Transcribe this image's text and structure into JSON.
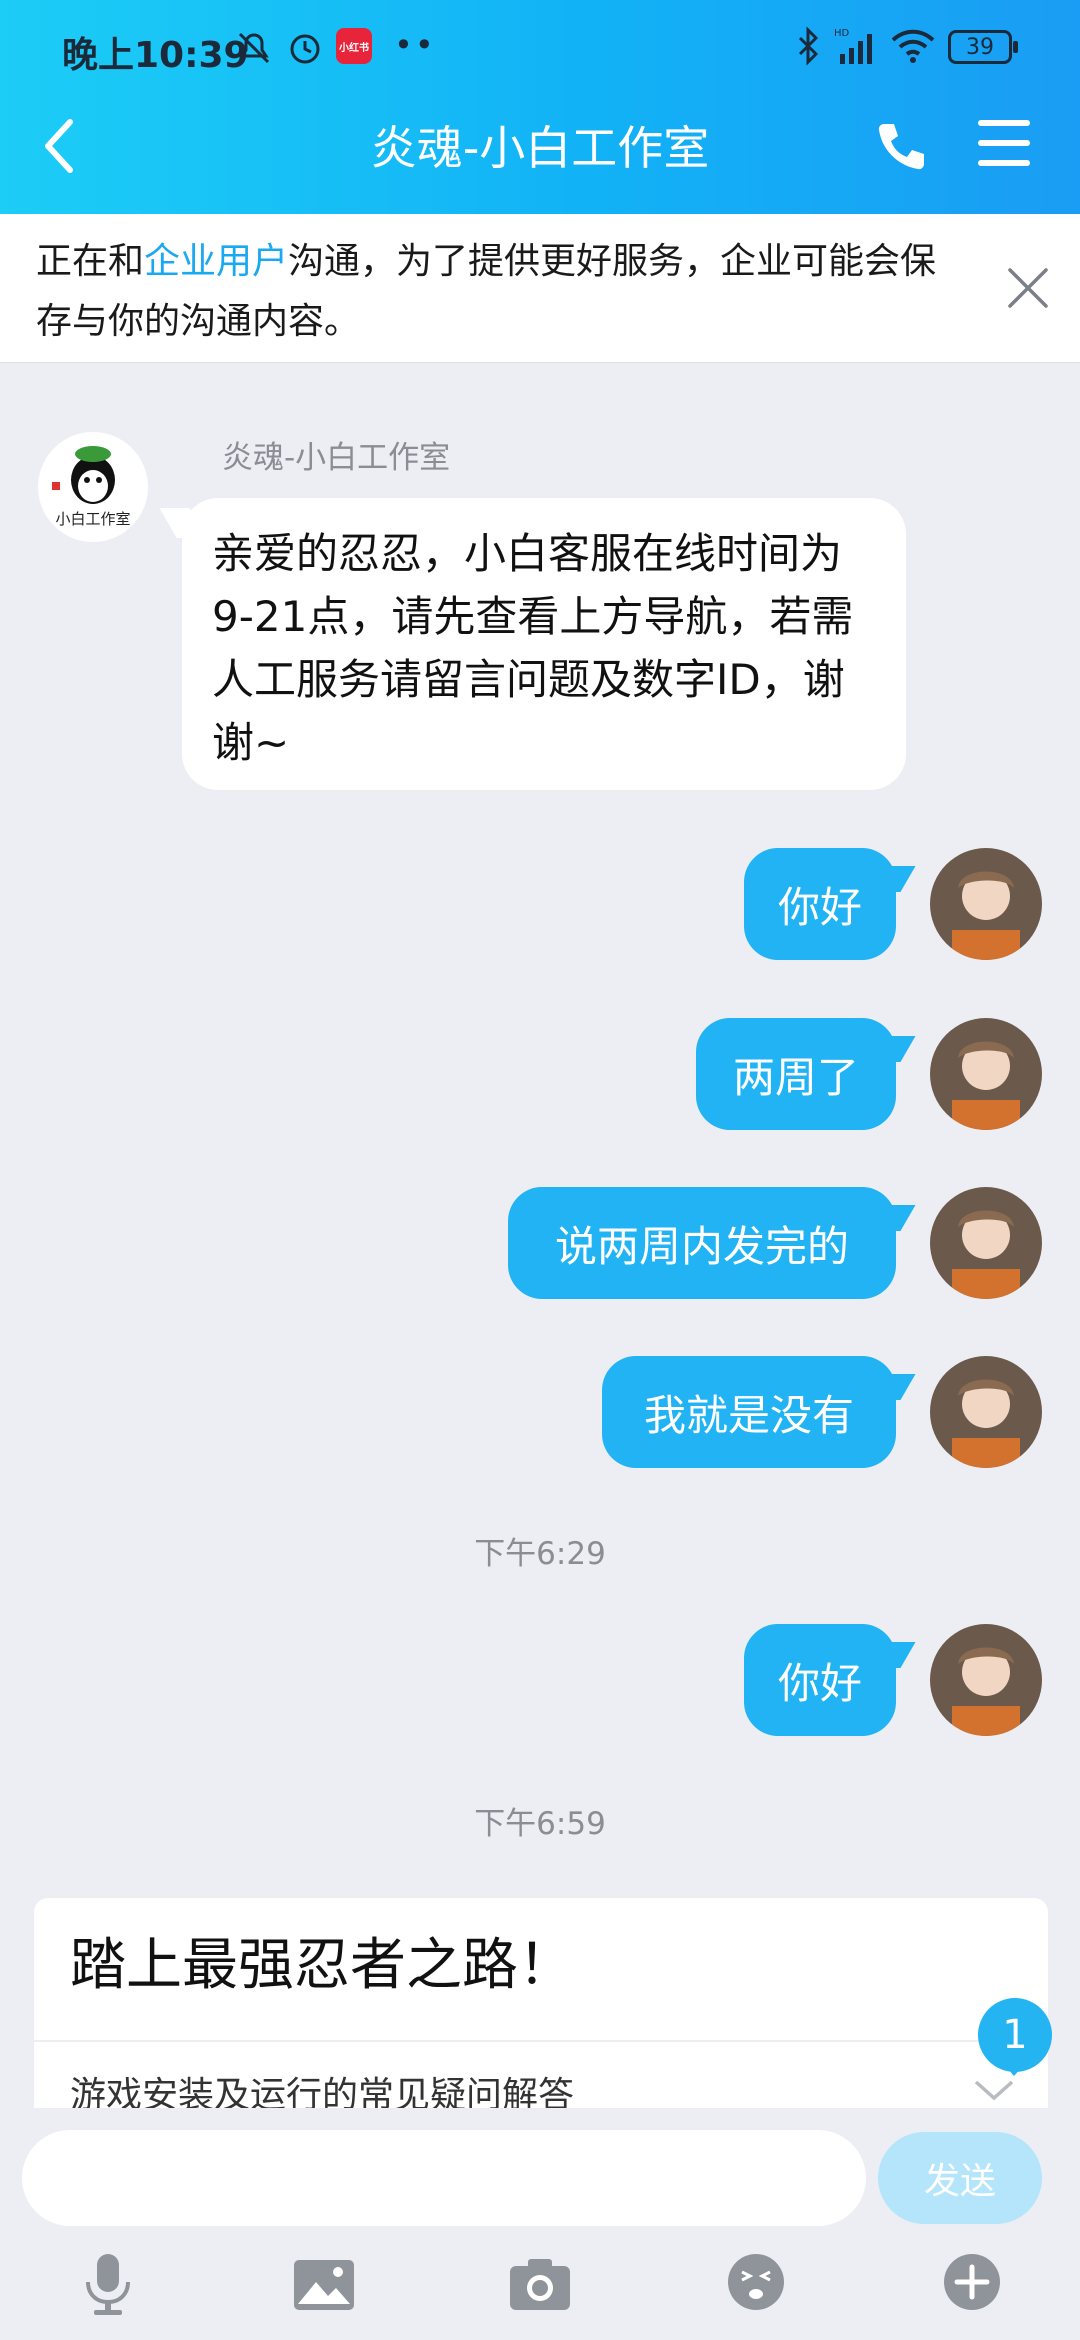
{
  "status_bar": {
    "time": "晚上10:39",
    "app_badge": "小红书",
    "dots": "••",
    "battery": "39"
  },
  "header": {
    "title": "炎魂-小白工作室"
  },
  "notice": {
    "prefix": "正在和",
    "highlight": "企业用户",
    "suffix": "沟通，为了提供更好服务，企业可能会保存与你的沟通内容。"
  },
  "messages": {
    "incoming": {
      "sender": "炎魂-小白工作室",
      "avatar_text": "小白工作室",
      "text": "亲爱的忍忍，小白客服在线时间为9-21点，请先查看上方导航，若需人工服务请留言问题及数字ID，谢谢~"
    },
    "outgoing": [
      "你好",
      "两周了",
      "说两周内发完的",
      "我就是没有",
      "你好"
    ],
    "timestamps": [
      "下午6:29",
      "下午6:59"
    ]
  },
  "card": {
    "title": "踏上最强忍者之路！",
    "item": "游戏安装及运行的常见疑问解答",
    "unread": "1"
  },
  "input": {
    "placeholder": "",
    "send_label": "发送"
  },
  "colors": {
    "accent": "#21b3f3",
    "header_start": "#1ccdf6",
    "header_end": "#1a9df4"
  }
}
